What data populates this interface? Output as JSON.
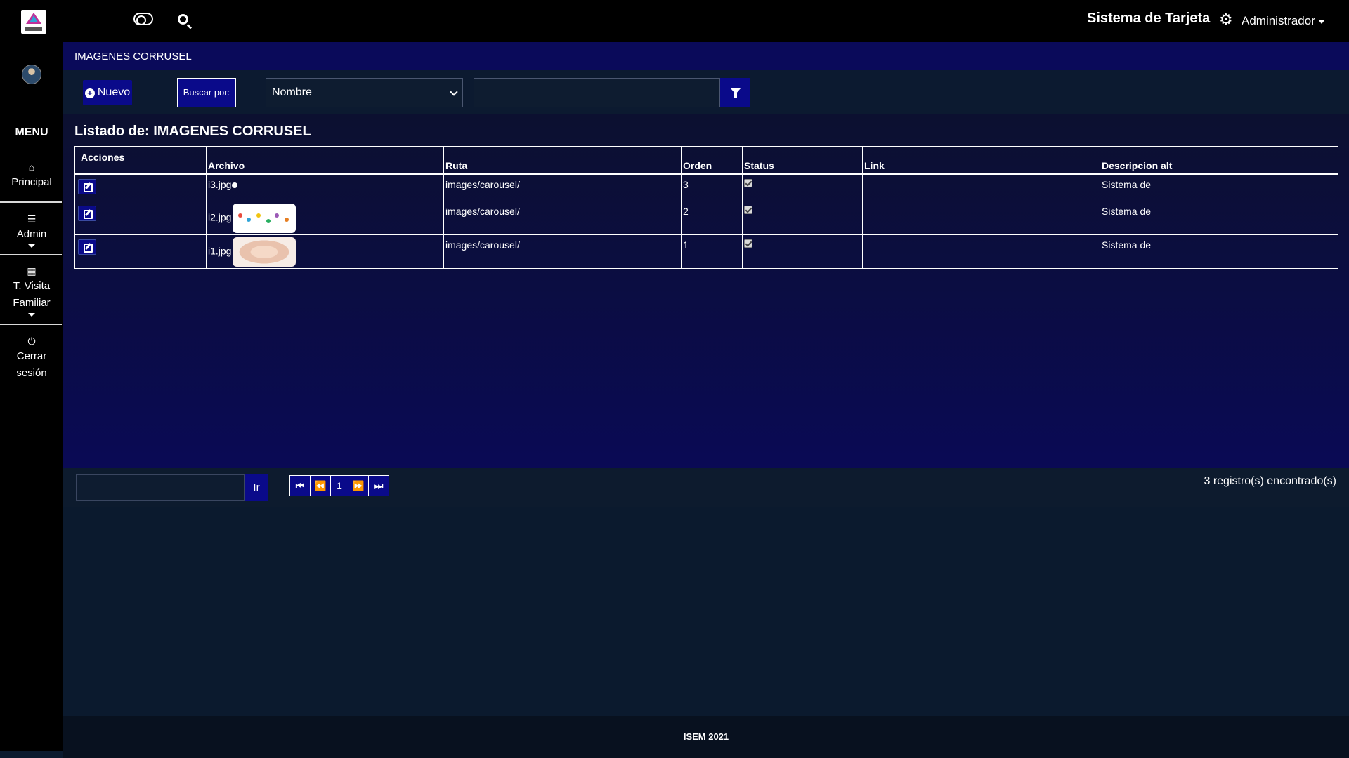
{
  "sidebar": {
    "menu_title": "MENU",
    "items": [
      {
        "label": "Principal",
        "icon": "home-icon"
      },
      {
        "label": "Admin",
        "icon": "bars-icon"
      },
      {
        "label": "T. Visita Familiar",
        "icon": "table-icon"
      },
      {
        "label": "Cerrar sesión",
        "icon": "power-icon"
      }
    ]
  },
  "topbar": {
    "system_title": "Sistema de Tarjeta",
    "user_label": "Administrador"
  },
  "breadcrumb": "IMAGENES CORRUSEL",
  "toolbar": {
    "new_label": "Nuevo",
    "search_by_label": "Buscar por:",
    "search_field_selected": "Nombre",
    "search_value": ""
  },
  "list": {
    "title": "Listado de: IMAGENES CORRUSEL",
    "columns": [
      "Acciones",
      "Archivo",
      "Ruta",
      "Orden",
      "Status",
      "Link",
      "Descripcion alt"
    ],
    "rows": [
      {
        "archivo": "i3.jpg",
        "ruta": "images/carousel/",
        "orden": "3",
        "status": true,
        "link": "",
        "descripcion": "Sistema de"
      },
      {
        "archivo": "i2.jpg",
        "ruta": "images/carousel/",
        "orden": "2",
        "status": true,
        "link": "",
        "descripcion": "Sistema de"
      },
      {
        "archivo": "i1.jpg",
        "ruta": "images/carousel/",
        "orden": "1",
        "status": true,
        "link": "",
        "descripcion": "Sistema de"
      }
    ]
  },
  "pager": {
    "go_label": "Ir",
    "current_page": "1",
    "count_text": "3 registro(s) encontrado(s)"
  },
  "footer": "ISEM 2021"
}
